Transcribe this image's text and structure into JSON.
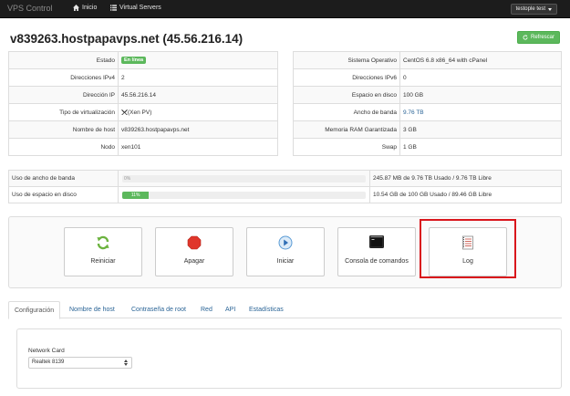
{
  "nav": {
    "brand": "VPS Control",
    "home_label": "Inicio",
    "virtual_servers_label": "Virtual Servers",
    "user_label": "testople test"
  },
  "header": {
    "title": "v839263.hostpapavps.net (45.56.216.14)",
    "refresh_label": "Refrescar"
  },
  "info_left": [
    {
      "label": "Estado",
      "value": "En línea"
    },
    {
      "label": "Direcciones IPv4",
      "value": "2"
    },
    {
      "label": "Dirección IP",
      "value": "45.56.216.14"
    },
    {
      "label": "Tipo de virtualización",
      "value": "(Xen PV)"
    },
    {
      "label": "Nombre de host",
      "value": "v839263.hostpapavps.net"
    },
    {
      "label": "Nodo",
      "value": "xen101"
    }
  ],
  "info_right": [
    {
      "label": "Sistema Operativo",
      "value": "CentOS 6.8 x86_64 with cPanel"
    },
    {
      "label": "Direcciones IPv6",
      "value": "0"
    },
    {
      "label": "Espacio en disco",
      "value": "100 GB"
    },
    {
      "label": "Ancho de banda",
      "value": "9.76 TB"
    },
    {
      "label": "Memoria RAM Garantizada",
      "value": "3 GB"
    },
    {
      "label": "Swap",
      "value": "1 GB"
    }
  ],
  "usage": [
    {
      "label": "Uso de ancho de banda",
      "bar_text": "0%",
      "percent": 0,
      "detail": "245.87 MB de 9.76 TB Usado / 9.76 TB Libre"
    },
    {
      "label": "Uso de espacio en disco",
      "bar_text": "11%",
      "percent": 11,
      "detail": "10.54 GB de 100 GB Usado / 89.46 GB Libre"
    }
  ],
  "actions": [
    {
      "label": "Reiniciar",
      "icon": "refresh-icon"
    },
    {
      "label": "Apagar",
      "icon": "stop-icon"
    },
    {
      "label": "Iniciar",
      "icon": "play-icon"
    },
    {
      "label": "Consola de comandos",
      "icon": "terminal-icon"
    },
    {
      "label": "Log",
      "icon": "log-icon"
    }
  ],
  "tabs": [
    "Configuración",
    "Nombre de host",
    "Contraseña de root",
    "Red",
    "API",
    "Estadísticas"
  ],
  "config": {
    "network_card_label": "Network Card",
    "network_card_value": "Realtek 8139"
  },
  "colors": {
    "navbar": "#1c1c1c",
    "success": "#5cb85c",
    "link": "#2a6496",
    "highlight": "#d9161c"
  }
}
